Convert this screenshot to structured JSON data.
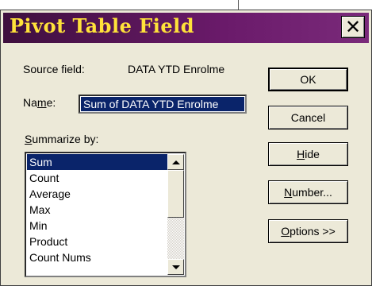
{
  "window": {
    "title": "Pivot Table Field",
    "close_glyph": "✕"
  },
  "source_field": {
    "label": "Source field:",
    "value": "DATA YTD Enrolme"
  },
  "name_field": {
    "label_pre": "Na",
    "label_mnemonic": "m",
    "label_post": "e:",
    "value": "Sum of DATA YTD Enrolme"
  },
  "summarize": {
    "label_mnemonic": "S",
    "label_rest": "ummarize by:",
    "items": [
      "Sum",
      "Count",
      "Average",
      "Max",
      "Min",
      "Product",
      "Count Nums"
    ],
    "selected": "Sum"
  },
  "buttons": {
    "ok": "OK",
    "cancel": "Cancel",
    "hide_mnemonic": "H",
    "hide_rest": "ide",
    "number_mnemonic": "N",
    "number_rest": "umber...",
    "options_mnemonic": "O",
    "options_rest": "ptions >>"
  },
  "icons": {
    "close": "close-icon",
    "scroll_up": "scroll-up-arrow-icon",
    "scroll_down": "scroll-down-arrow-icon"
  },
  "colors": {
    "title_text": "#ffe23a",
    "title_bar": "#5a145a",
    "selection": "#0a246a"
  }
}
